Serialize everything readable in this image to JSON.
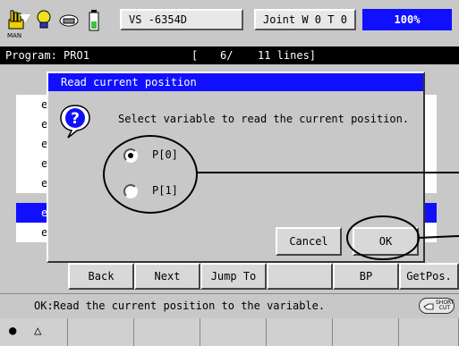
{
  "topbar": {
    "mode_label": "MAN",
    "icons": [
      "hand-icon",
      "lightbulb-icon",
      "tool-icon",
      "battery-icon"
    ],
    "robot_name": "VS  -6354D",
    "coord_mode": "Joint  W 0 T 0",
    "speed": "100%"
  },
  "program_bar": {
    "program": "Program: PRO1",
    "bracket_open": "[",
    "line_pos": "6/",
    "lines": "11 lines]"
  },
  "list_rows": [
    "e",
    "e",
    "e",
    "e",
    "e",
    "e",
    "e"
  ],
  "dialog": {
    "title": "Read current position",
    "icon": "question-icon",
    "prompt": "Select variable to read the current position.",
    "options": [
      {
        "label": "P[0]",
        "selected": true
      },
      {
        "label": "P[1]",
        "selected": false
      }
    ],
    "cancel_label": "Cancel",
    "ok_label": "OK"
  },
  "fkeys": [
    "Back",
    "Next",
    "Jump To",
    "",
    "BP",
    "GetPos."
  ],
  "message": "OK:Read the current position to the variable.",
  "shortcut_label": "SHORT CUT",
  "bottom_keys": [
    "●",
    "△"
  ],
  "colors": {
    "accent": "#1010ff",
    "panel": "#c8c8c8",
    "annotation": "#000000"
  }
}
